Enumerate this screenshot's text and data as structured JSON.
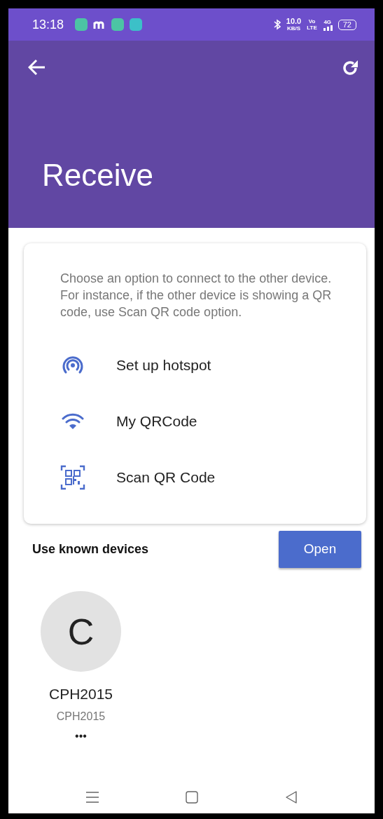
{
  "status_bar": {
    "time": "13:18",
    "net_speed": "10.0",
    "net_unit": "KB/S",
    "volte_top": "Vo",
    "volte_bottom": "LTE",
    "network": "4G",
    "battery": "72"
  },
  "app_bar": {
    "title": "Receive"
  },
  "card": {
    "description": "Choose an option to connect to the other device. For instance, if the other device is showing a QR code, use Scan QR code option.",
    "options": [
      {
        "kind": "hotspot",
        "label": "Set up hotspot"
      },
      {
        "kind": "wifi",
        "label": "My QRCode"
      },
      {
        "kind": "qr",
        "label": "Scan QR Code"
      }
    ]
  },
  "known_devices": {
    "heading": "Use known devices",
    "button": "Open",
    "devices": [
      {
        "initial": "C",
        "name": "CPH2015",
        "subtitle": "CPH2015",
        "menu": "•••"
      }
    ]
  }
}
